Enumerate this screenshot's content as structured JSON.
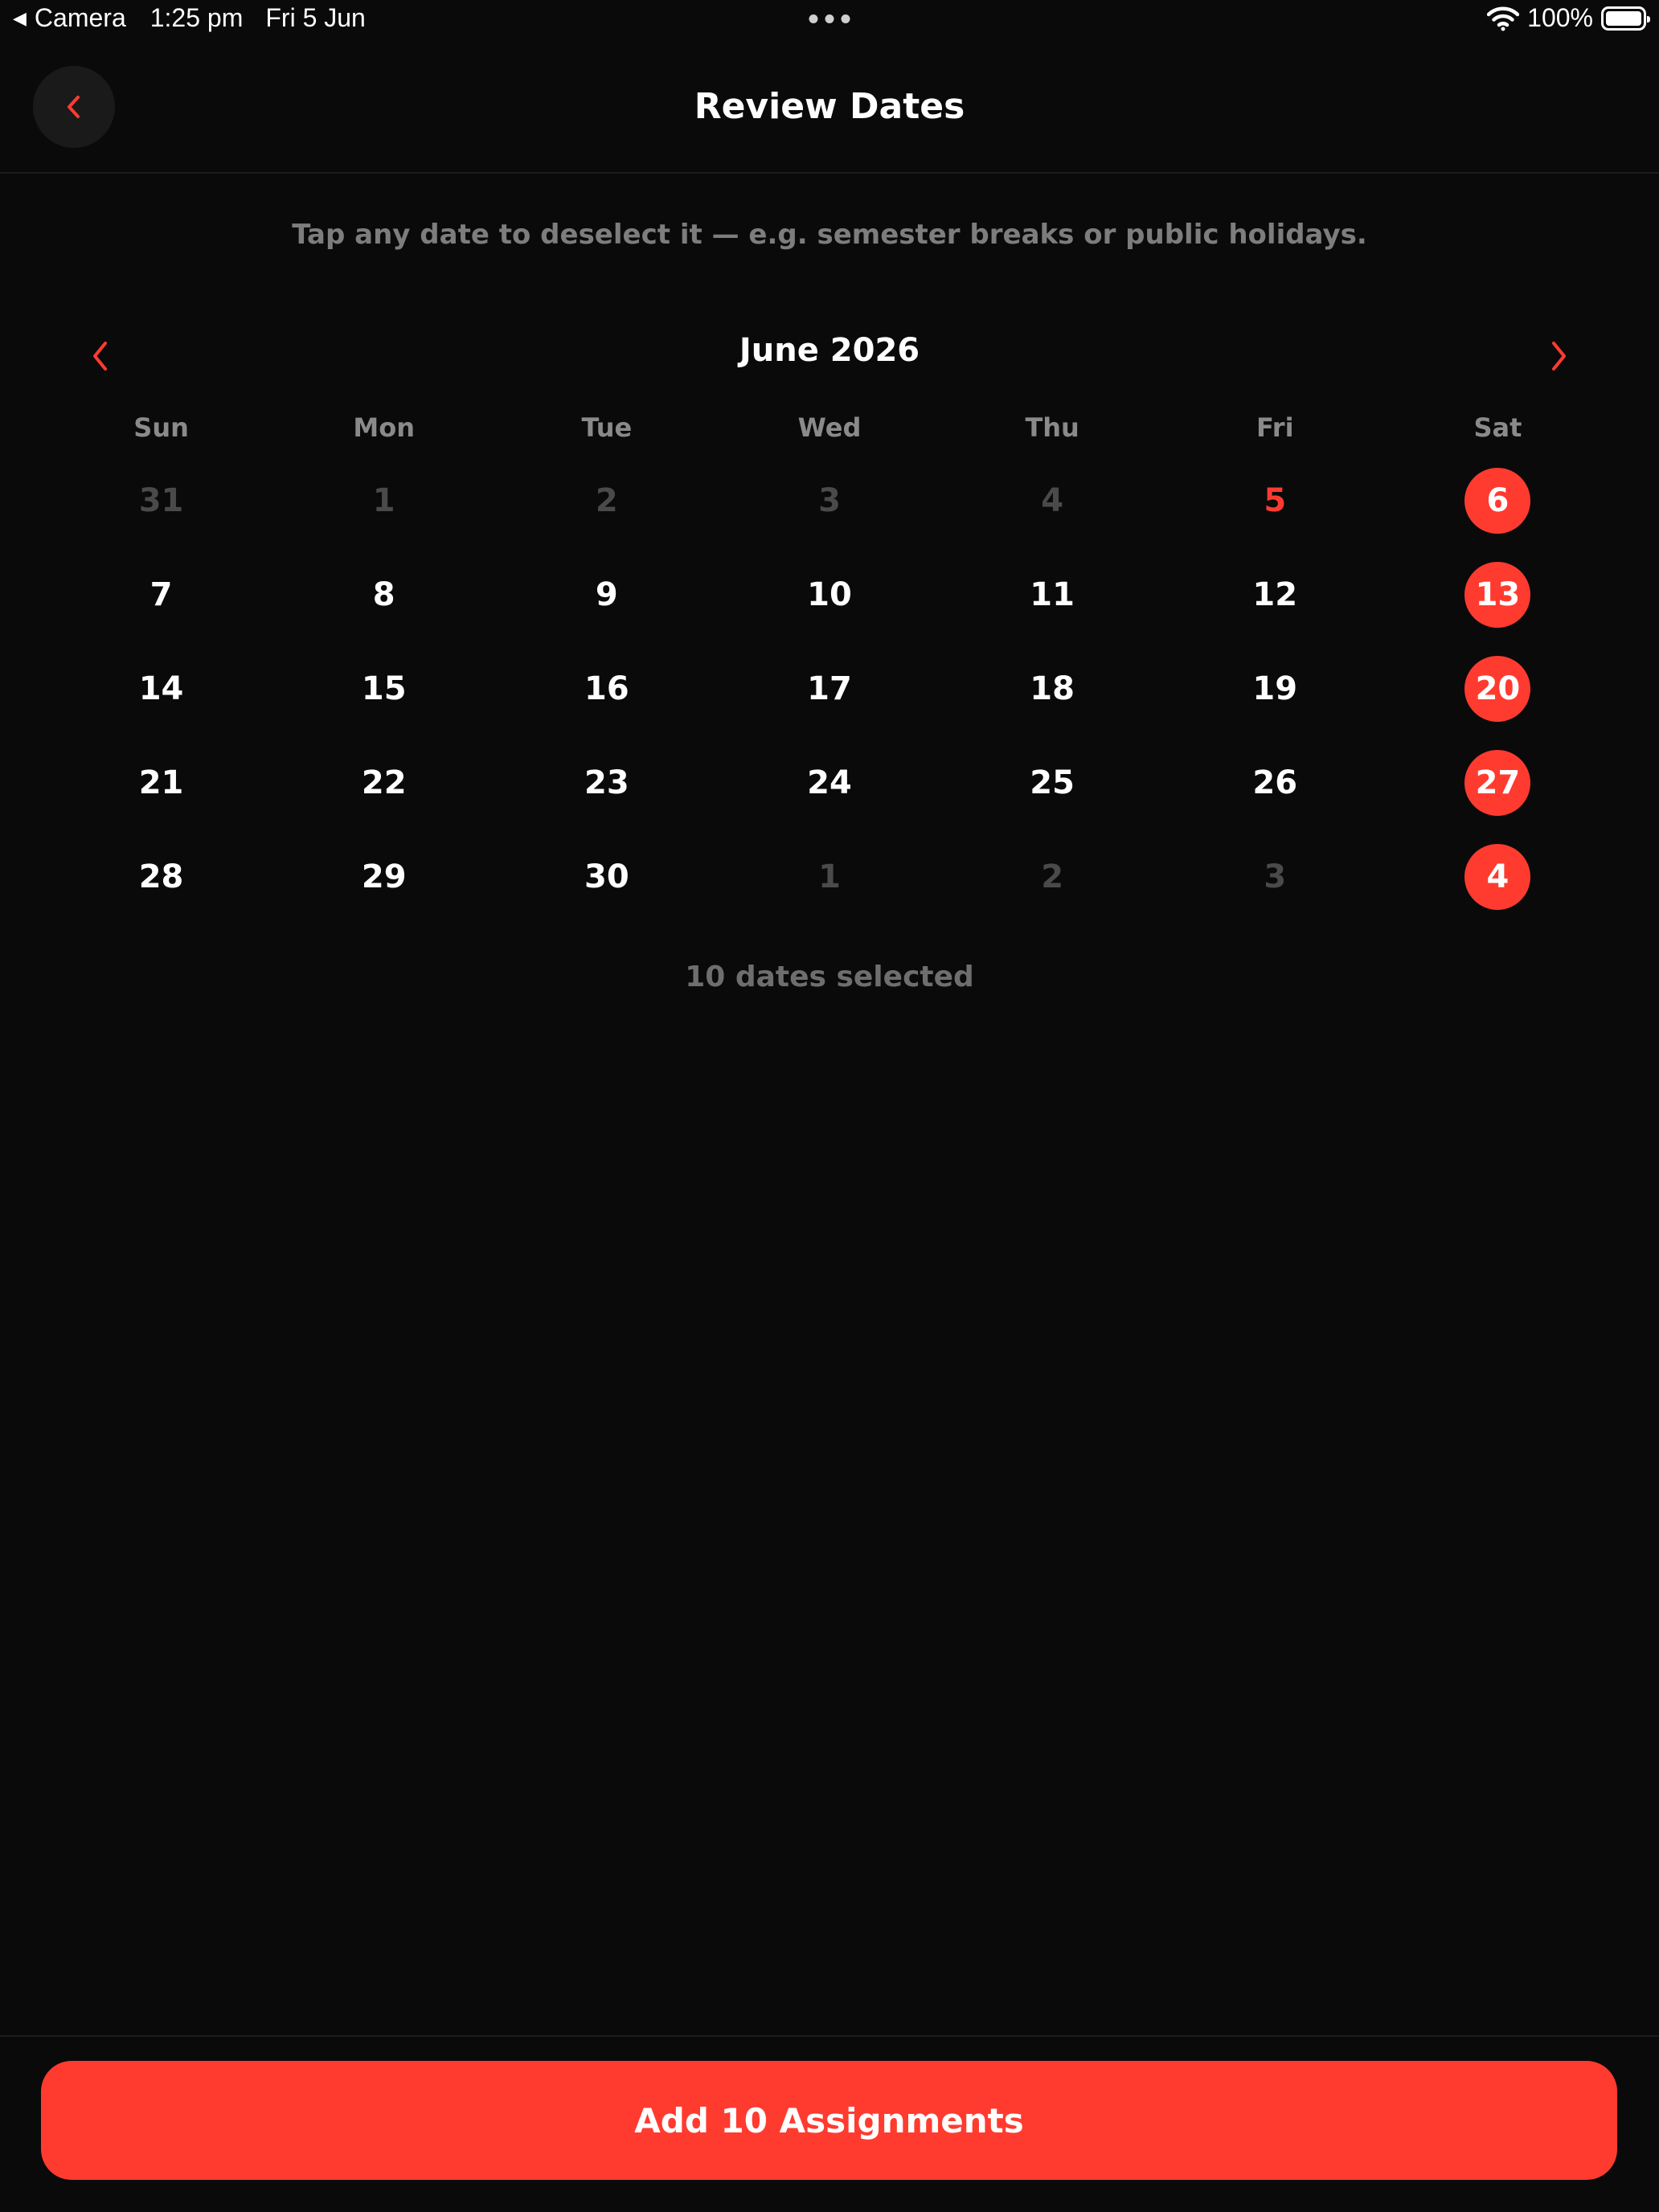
{
  "status_bar": {
    "back_app": "Camera",
    "time": "1:25 pm",
    "date": "Fri 5 Jun",
    "battery": "100%"
  },
  "header": {
    "title": "Review Dates",
    "back_icon": "chevron-left-icon"
  },
  "hint": "Tap any date to deselect it — e.g. semester breaks or public holidays.",
  "calendar": {
    "month_label": "June 2026",
    "weekdays": [
      "Sun",
      "Mon",
      "Tue",
      "Wed",
      "Thu",
      "Fri",
      "Sat"
    ],
    "weeks": [
      [
        {
          "label": "31",
          "state": "outside"
        },
        {
          "label": "1",
          "state": "outside"
        },
        {
          "label": "2",
          "state": "outside"
        },
        {
          "label": "3",
          "state": "outside"
        },
        {
          "label": "4",
          "state": "outside"
        },
        {
          "label": "5",
          "state": "today"
        },
        {
          "label": "6",
          "state": "selected"
        }
      ],
      [
        {
          "label": "7",
          "state": "normal"
        },
        {
          "label": "8",
          "state": "normal"
        },
        {
          "label": "9",
          "state": "normal"
        },
        {
          "label": "10",
          "state": "normal"
        },
        {
          "label": "11",
          "state": "normal"
        },
        {
          "label": "12",
          "state": "normal"
        },
        {
          "label": "13",
          "state": "selected"
        }
      ],
      [
        {
          "label": "14",
          "state": "normal"
        },
        {
          "label": "15",
          "state": "normal"
        },
        {
          "label": "16",
          "state": "normal"
        },
        {
          "label": "17",
          "state": "normal"
        },
        {
          "label": "18",
          "state": "normal"
        },
        {
          "label": "19",
          "state": "normal"
        },
        {
          "label": "20",
          "state": "selected"
        }
      ],
      [
        {
          "label": "21",
          "state": "normal"
        },
        {
          "label": "22",
          "state": "normal"
        },
        {
          "label": "23",
          "state": "normal"
        },
        {
          "label": "24",
          "state": "normal"
        },
        {
          "label": "25",
          "state": "normal"
        },
        {
          "label": "26",
          "state": "normal"
        },
        {
          "label": "27",
          "state": "selected"
        }
      ],
      [
        {
          "label": "28",
          "state": "normal"
        },
        {
          "label": "29",
          "state": "normal"
        },
        {
          "label": "30",
          "state": "normal"
        },
        {
          "label": "1",
          "state": "outside"
        },
        {
          "label": "2",
          "state": "outside"
        },
        {
          "label": "3",
          "state": "outside"
        },
        {
          "label": "4",
          "state": "selected"
        }
      ]
    ],
    "selected_count": "10 dates selected"
  },
  "primary_button": "Add 10 Assignments",
  "colors": {
    "accent": "#ff3b30",
    "background": "#0a0a0a",
    "muted_text": "#7d7d7d",
    "outside_day": "#4a4a4a"
  }
}
